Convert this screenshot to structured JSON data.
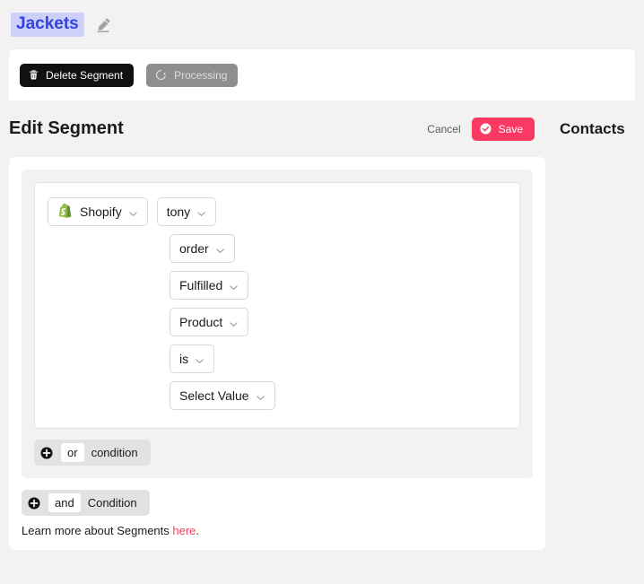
{
  "segment": {
    "name": "Jackets",
    "edit_icon": "pencil-icon"
  },
  "actions": {
    "delete_label": "Delete Segment",
    "delete_icon": "trash-icon",
    "processing_label": "Processing",
    "processing_icon": "refresh-icon"
  },
  "header": {
    "title": "Edit Segment",
    "cancel_label": "Cancel",
    "save_label": "Save",
    "save_icon": "check-circle-icon",
    "contacts_label": "Contacts"
  },
  "condition": {
    "source": {
      "label": "Shopify",
      "icon": "shopify-icon",
      "chevron": "chevron-down-icon"
    },
    "fields": [
      {
        "label": "tony",
        "chevron": "chevron-down-icon"
      },
      {
        "label": "order",
        "chevron": "chevron-down-icon"
      },
      {
        "label": "Fulfilled",
        "chevron": "chevron-down-icon"
      },
      {
        "label": "Product",
        "chevron": "chevron-down-icon"
      },
      {
        "label": "is",
        "chevron": "chevron-down-icon"
      },
      {
        "label": "Select Value",
        "chevron": "chevron-down-icon"
      }
    ]
  },
  "add_buttons": {
    "or": {
      "plus_icon": "plus-circle-icon",
      "operator": "or",
      "label": "condition"
    },
    "and": {
      "plus_icon": "plus-circle-icon",
      "operator": "and",
      "label": "Condition"
    }
  },
  "footer": {
    "text_before": "Learn more about Segments ",
    "link_label": "here",
    "text_after": "."
  },
  "colors": {
    "accent_pink": "#fb3a63",
    "name_text": "#3344dd",
    "name_highlight": "#ccd0fb",
    "page_bg": "#f2f2f2",
    "shopify_green": "#7ab55c",
    "dark_button": "#111111",
    "processing_gray": "#8e8e8e"
  }
}
